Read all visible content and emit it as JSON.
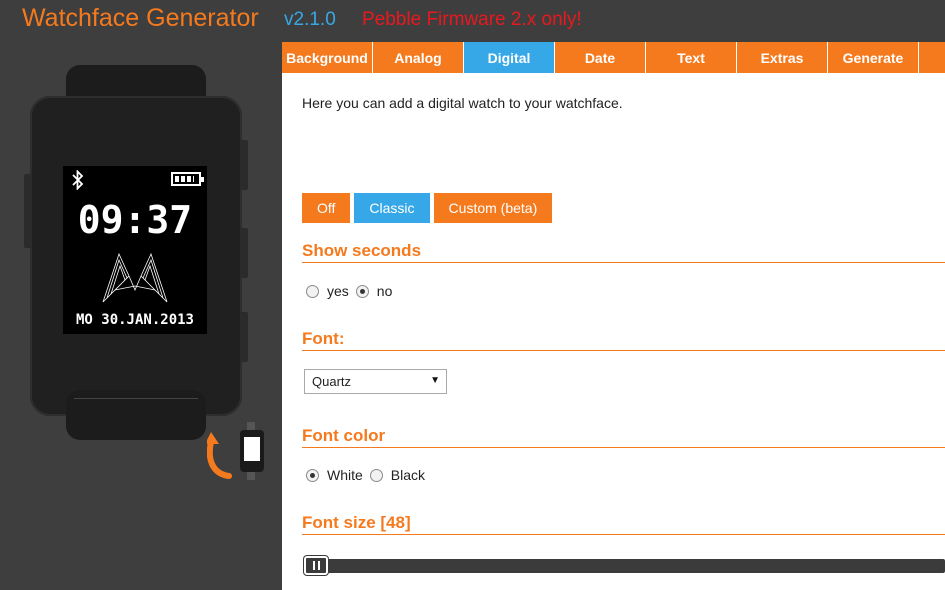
{
  "header": {
    "title": "Watchface Generator",
    "version": "v2.1.0",
    "warning": "Pebble Firmware 2.x only!"
  },
  "tabs": [
    {
      "label": "Background"
    },
    {
      "label": "Analog"
    },
    {
      "label": "Digital"
    },
    {
      "label": "Date"
    },
    {
      "label": "Text"
    },
    {
      "label": "Extras"
    },
    {
      "label": "Generate"
    }
  ],
  "active_tab": "Digital",
  "digital": {
    "intro": "Here you can add a digital watch to your watchface.",
    "modes": [
      {
        "label": "Off"
      },
      {
        "label": "Classic"
      },
      {
        "label": "Custom (beta)"
      }
    ],
    "active_mode": "Classic",
    "show_seconds": {
      "title": "Show seconds",
      "options": [
        {
          "label": "yes"
        },
        {
          "label": "no"
        }
      ],
      "selected": "no"
    },
    "font": {
      "title": "Font:",
      "selected": "Quartz"
    },
    "font_color": {
      "title": "Font color",
      "options": [
        {
          "label": "White"
        },
        {
          "label": "Black"
        }
      ],
      "selected": "White"
    },
    "font_size": {
      "title": "Font size [48]",
      "value": 48
    }
  },
  "preview": {
    "time": "09:37",
    "date": "MO 30.JAN.2013",
    "bluetooth_icon": "bluetooth-icon",
    "battery_icon": "battery-icon",
    "battery_level": 0.85,
    "flip_icon": "flip-watch-icon"
  },
  "colors": {
    "accent": "#f57a1e",
    "active": "#36a8e8",
    "warning": "#e8191e",
    "background": "#3e3e3e"
  }
}
